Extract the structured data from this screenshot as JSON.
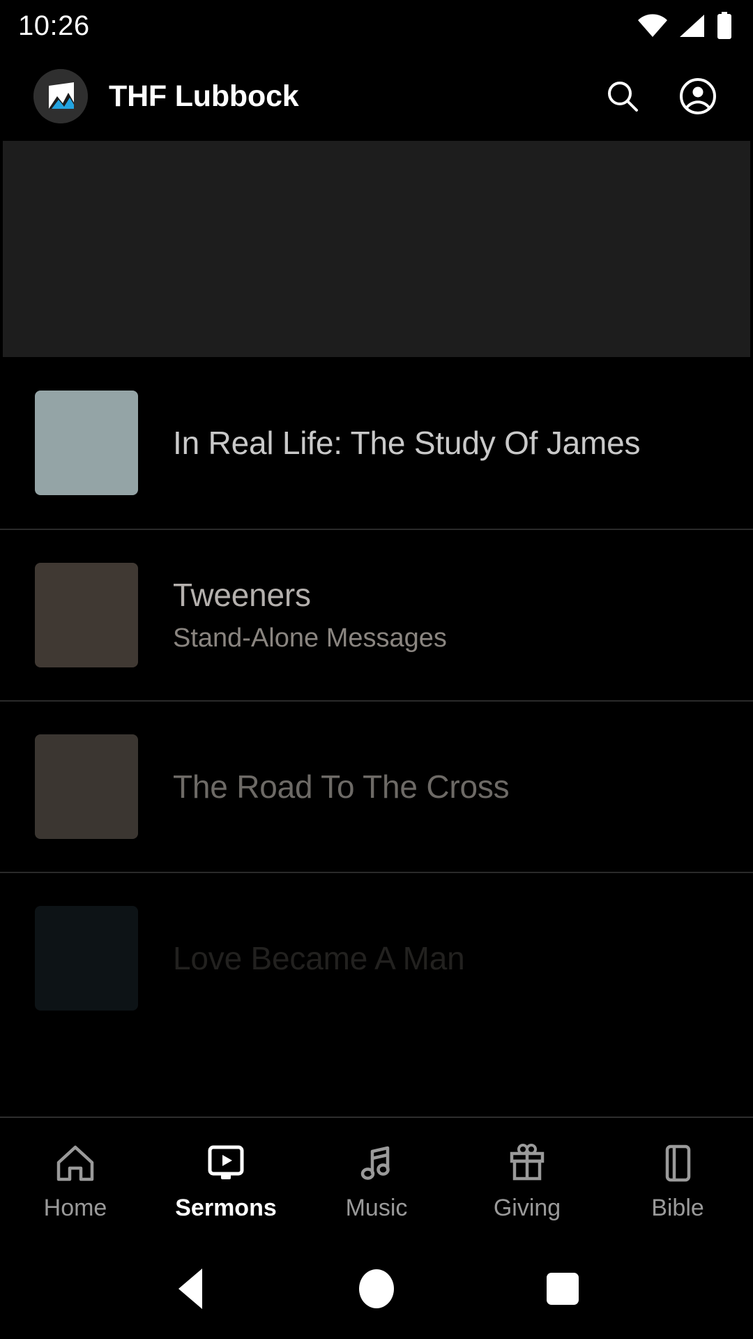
{
  "status_bar": {
    "clock": "10:26",
    "icons": [
      "wifi-icon",
      "cellular-signal-icon",
      "battery-full-icon"
    ]
  },
  "app_bar": {
    "logo_icon": "mountain-logo-icon",
    "title": "THF Lubbock",
    "search_icon": "search-icon",
    "account_icon": "account-circle-icon"
  },
  "banner": {
    "placeholder_color": "#1d1d1d"
  },
  "sermons": {
    "items": [
      {
        "title": "In Real Life: The Study Of James",
        "subtitle": "",
        "thumb_color": "#94a4a6",
        "title_color": "#c9c9c9",
        "subtitle_color": "#8d8d8d",
        "opacity": 1
      },
      {
        "title": "Tweeners",
        "subtitle": "Stand-Alone Messages",
        "thumb_color": "#403933",
        "title_color": "#b4b0ad",
        "subtitle_color": "#8a8580",
        "opacity": 1
      },
      {
        "title": "The Road To The Cross",
        "subtitle": "",
        "thumb_color": "#3b3631",
        "title_color": "#6d6a66",
        "subtitle_color": "#5a5754",
        "opacity": 1
      },
      {
        "title": "Love Became A Man",
        "subtitle": "",
        "thumb_color": "#0d1316",
        "title_color": "#22211f",
        "subtitle_color": "#1a1917",
        "opacity": 1
      }
    ]
  },
  "tab_bar": {
    "active": "Sermons",
    "tabs": [
      {
        "label": "Home",
        "icon": "home-icon",
        "active": false
      },
      {
        "label": "Sermons",
        "icon": "sermons-video-icon",
        "active": true
      },
      {
        "label": "Music",
        "icon": "music-note-icon",
        "active": false
      },
      {
        "label": "Giving",
        "icon": "gift-icon",
        "active": false
      },
      {
        "label": "Bible",
        "icon": "book-icon",
        "active": false
      }
    ]
  },
  "nav_bar": {
    "back_label": "back-button",
    "home_label": "home-button",
    "recents_label": "recents-button"
  },
  "colors": {
    "background": "#000000",
    "banner": "#1d1d1d",
    "divider": "#2a2a2a",
    "tab_inactive": "#9a9a9a",
    "tab_active": "#ffffff",
    "logo_accent": "#23a3e0"
  }
}
